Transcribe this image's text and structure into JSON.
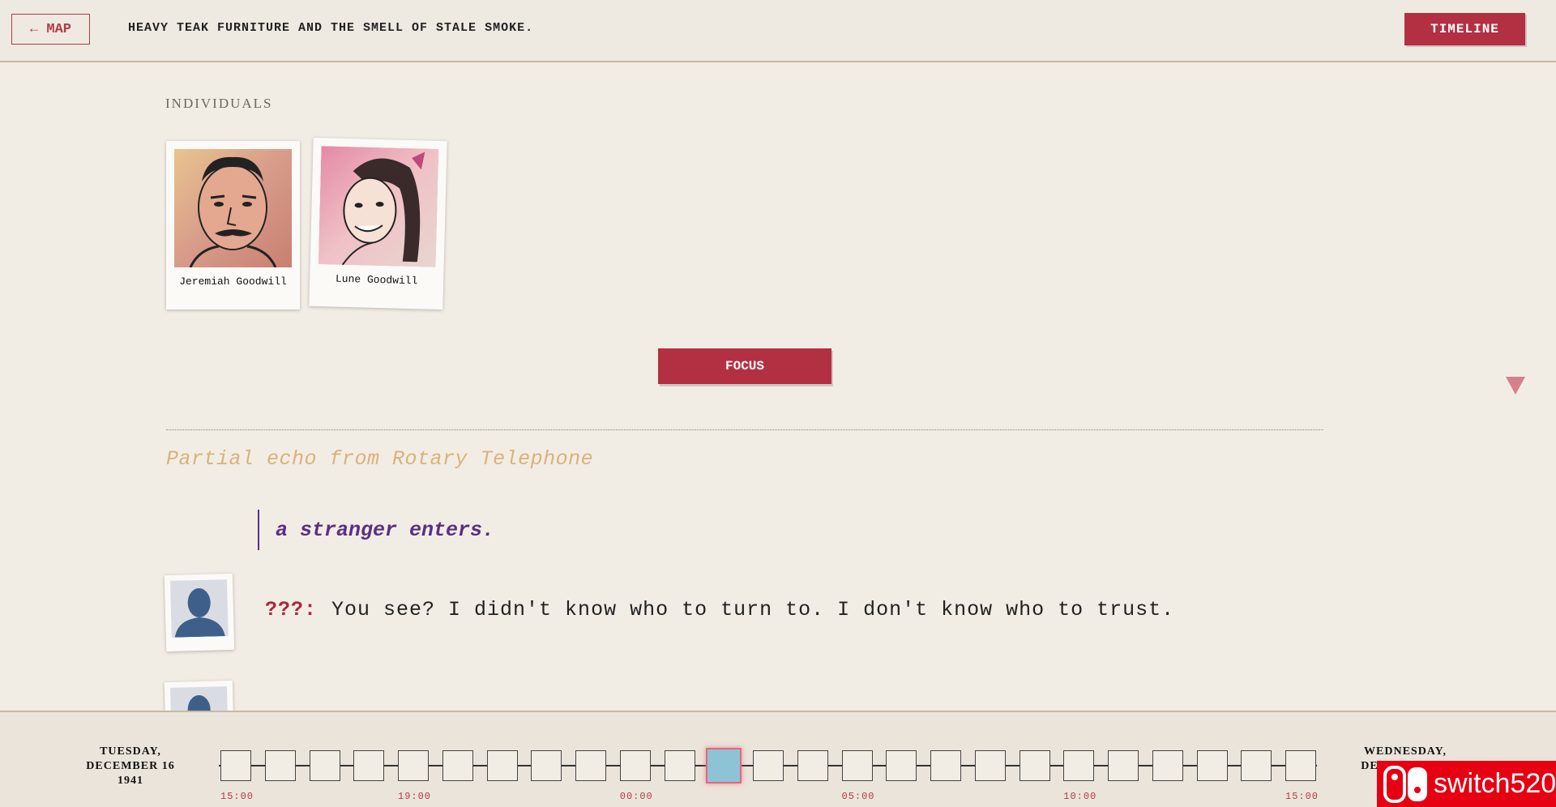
{
  "header": {
    "map_label": "← MAP",
    "description": "HEAVY TEAK FURNITURE AND THE SMELL OF STALE SMOKE.",
    "timeline_label": "TIMELINE"
  },
  "individuals": {
    "section_label": "INDIVIDUALS",
    "people": [
      {
        "name": "Jeremiah Goodwill"
      },
      {
        "name": "Lune Goodwill"
      }
    ]
  },
  "focus_label": "FOCUS",
  "echo": {
    "title": "Partial echo from Rotary Telephone",
    "stage_direction": "a stranger enters.",
    "lines": [
      {
        "speaker": "???:",
        "text": "You see? I didn't know who to turn to. I don't know who to trust."
      }
    ]
  },
  "timeline": {
    "start_date": [
      "TUESDAY,",
      "DECEMBER 16",
      "1941"
    ],
    "end_date": [
      "WEDNESDAY,",
      "DECEMBER 17"
    ],
    "slot_count": 25,
    "active_slot": 11,
    "tick_labels": [
      "15:00",
      "19:00",
      "00:00",
      "05:00",
      "10:00",
      "15:00"
    ]
  },
  "badge": {
    "label": "switch520"
  },
  "colors": {
    "accent": "#b32f42",
    "background": "#f2ede4",
    "stage_direction": "#5a2f86",
    "echo_title": "#d9b27a",
    "active_slot": "#8ec3d6"
  }
}
